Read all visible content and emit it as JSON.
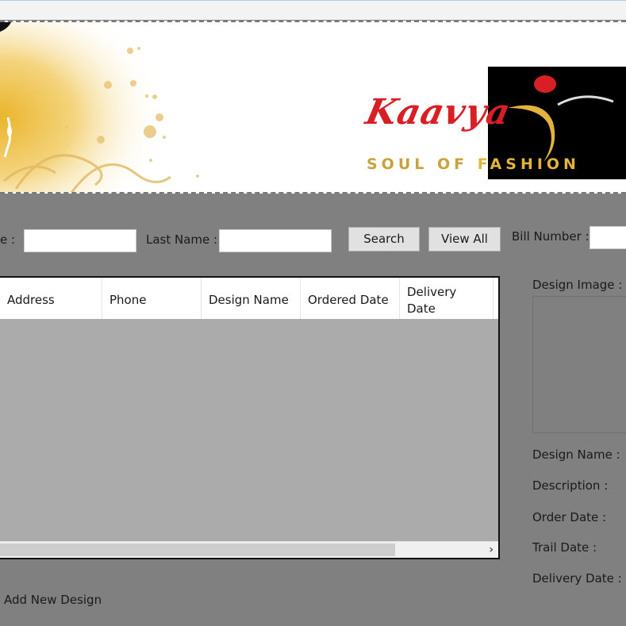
{
  "banner": {
    "brand_name": "Kaavya",
    "tagline_part1": "SOUL OF",
    "tagline_part2": "FASHION",
    "colors": {
      "brand_red": "#d81f26",
      "gold": "#e3b43a",
      "logo_bg": "#000000"
    }
  },
  "search": {
    "first_name_label": "e :",
    "first_name_value": "",
    "last_name_label": "Last Name :",
    "last_name_value": "",
    "search_button": "Search",
    "view_all_button": "View All",
    "bill_number_label": "Bill Number :",
    "bill_number_value": ""
  },
  "grid": {
    "columns": [
      {
        "label": "Address"
      },
      {
        "label": "Phone"
      },
      {
        "label": "Design Name"
      },
      {
        "label": "Ordered Date"
      },
      {
        "label": "Delivery Date"
      }
    ],
    "rows": [],
    "scroll_right_glyph": "›"
  },
  "details": {
    "design_image_label": "Design Image :",
    "design_name_label": "Design Name :",
    "description_label": "Description :",
    "order_date_label": "Order Date :",
    "trail_date_label": "Trail Date :",
    "delivery_date_label": "Delivery Date :"
  },
  "actions": {
    "add_new_design": "Add New Design"
  }
}
